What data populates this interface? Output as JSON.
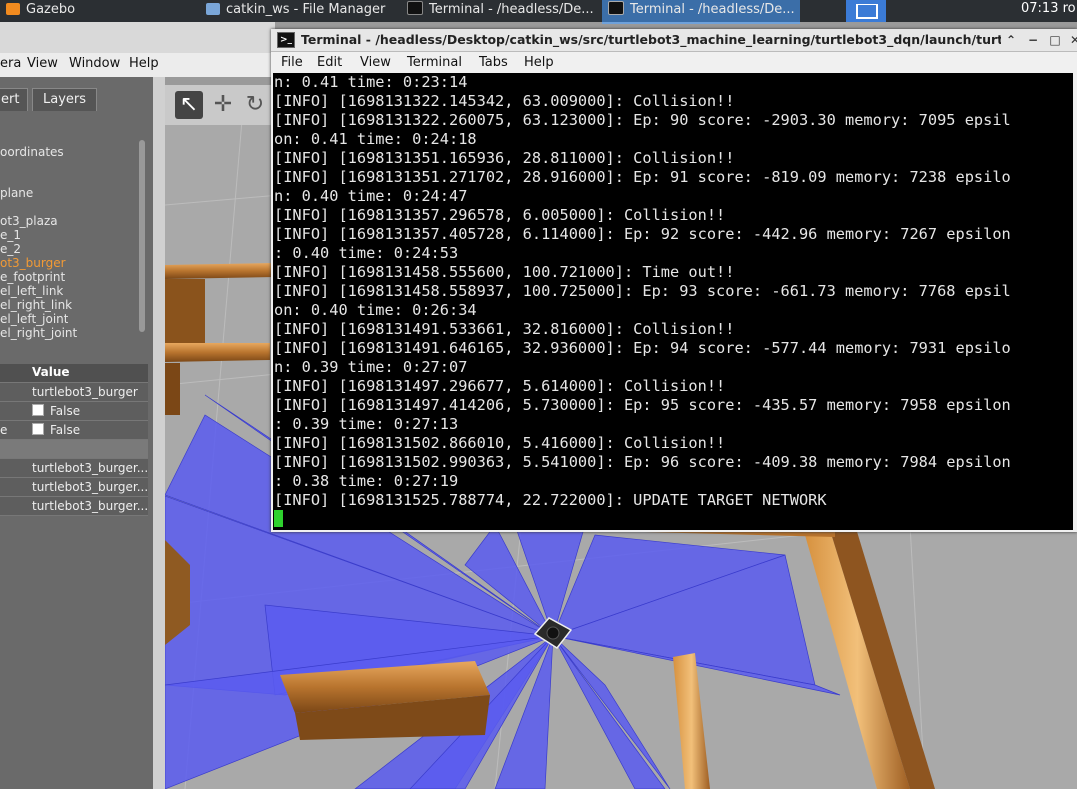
{
  "taskbar": {
    "tasks": [
      {
        "label": "Gazebo",
        "icon": "gazebo-icon"
      },
      {
        "label": "catkin_ws - File Manager",
        "icon": "folder-icon"
      },
      {
        "label": "Terminal - /headless/De...",
        "icon": "terminal-icon"
      },
      {
        "label": "Terminal - /headless/De...",
        "icon": "terminal-icon",
        "active": true
      }
    ],
    "clock": "07:13 ro"
  },
  "gazebo": {
    "menu": [
      "era",
      "View",
      "Window",
      "Help"
    ],
    "tabs": [
      "ert",
      "Layers"
    ],
    "tree": [
      "oordinates",
      "plane",
      "ot3_plaza",
      "e_1",
      "e_2",
      "ot3_burger",
      "e_footprint",
      "el_left_link",
      "el_right_link",
      "el_left_joint",
      "el_right_joint"
    ],
    "tree_selected_index": 5,
    "props": {
      "header": "Value",
      "rows": [
        {
          "label": "",
          "value": "turtlebot3_burger"
        },
        {
          "label": "",
          "value": "False",
          "checkbox": true
        },
        {
          "label": "e",
          "value": "False",
          "checkbox": true
        },
        {
          "label": "",
          "value": ""
        },
        {
          "label": "",
          "value": "turtlebot3_burger..."
        },
        {
          "label": "",
          "value": "turtlebot3_burger..."
        },
        {
          "label": "",
          "value": "turtlebot3_burger..."
        }
      ]
    },
    "colors": {
      "selected": "#f29a35",
      "laser": "#5a5cf0",
      "wall": "#c98a43",
      "ground": "#a7a7a7"
    }
  },
  "terminal": {
    "title": "Terminal - /headless/Desktop/catkin_ws/src/turtlebot3_machine_learning/turtlebot3_dqn/launch/turtleb",
    "menu": [
      "File",
      "Edit",
      "View",
      "Terminal",
      "Tabs",
      "Help"
    ],
    "lines": [
      "n: 0.41 time: 0:23:14",
      "[INFO] [1698131322.145342, 63.009000]: Collision!!",
      "[INFO] [1698131322.260075, 63.123000]: Ep: 90 score: -2903.30 memory: 7095 epsil",
      "on: 0.41 time: 0:24:18",
      "[INFO] [1698131351.165936, 28.811000]: Collision!!",
      "[INFO] [1698131351.271702, 28.916000]: Ep: 91 score: -819.09 memory: 7238 epsilo",
      "n: 0.40 time: 0:24:47",
      "[INFO] [1698131357.296578, 6.005000]: Collision!!",
      "[INFO] [1698131357.405728, 6.114000]: Ep: 92 score: -442.96 memory: 7267 epsilon",
      ": 0.40 time: 0:24:53",
      "[INFO] [1698131458.555600, 100.721000]: Time out!!",
      "[INFO] [1698131458.558937, 100.725000]: Ep: 93 score: -661.73 memory: 7768 epsil",
      "on: 0.40 time: 0:26:34",
      "[INFO] [1698131491.533661, 32.816000]: Collision!!",
      "[INFO] [1698131491.646165, 32.936000]: Ep: 94 score: -577.44 memory: 7931 epsilo",
      "n: 0.39 time: 0:27:07",
      "[INFO] [1698131497.296677, 5.614000]: Collision!!",
      "[INFO] [1698131497.414206, 5.730000]: Ep: 95 score: -435.57 memory: 7958 epsilon",
      ": 0.39 time: 0:27:13",
      "[INFO] [1698131502.866010, 5.416000]: Collision!!",
      "[INFO] [1698131502.990363, 5.541000]: Ep: 96 score: -409.38 memory: 7984 epsilon",
      ": 0.38 time: 0:27:19",
      "[INFO] [1698131525.788774, 22.722000]: UPDATE TARGET NETWORK"
    ],
    "cursor_color": "#2ed12e"
  }
}
